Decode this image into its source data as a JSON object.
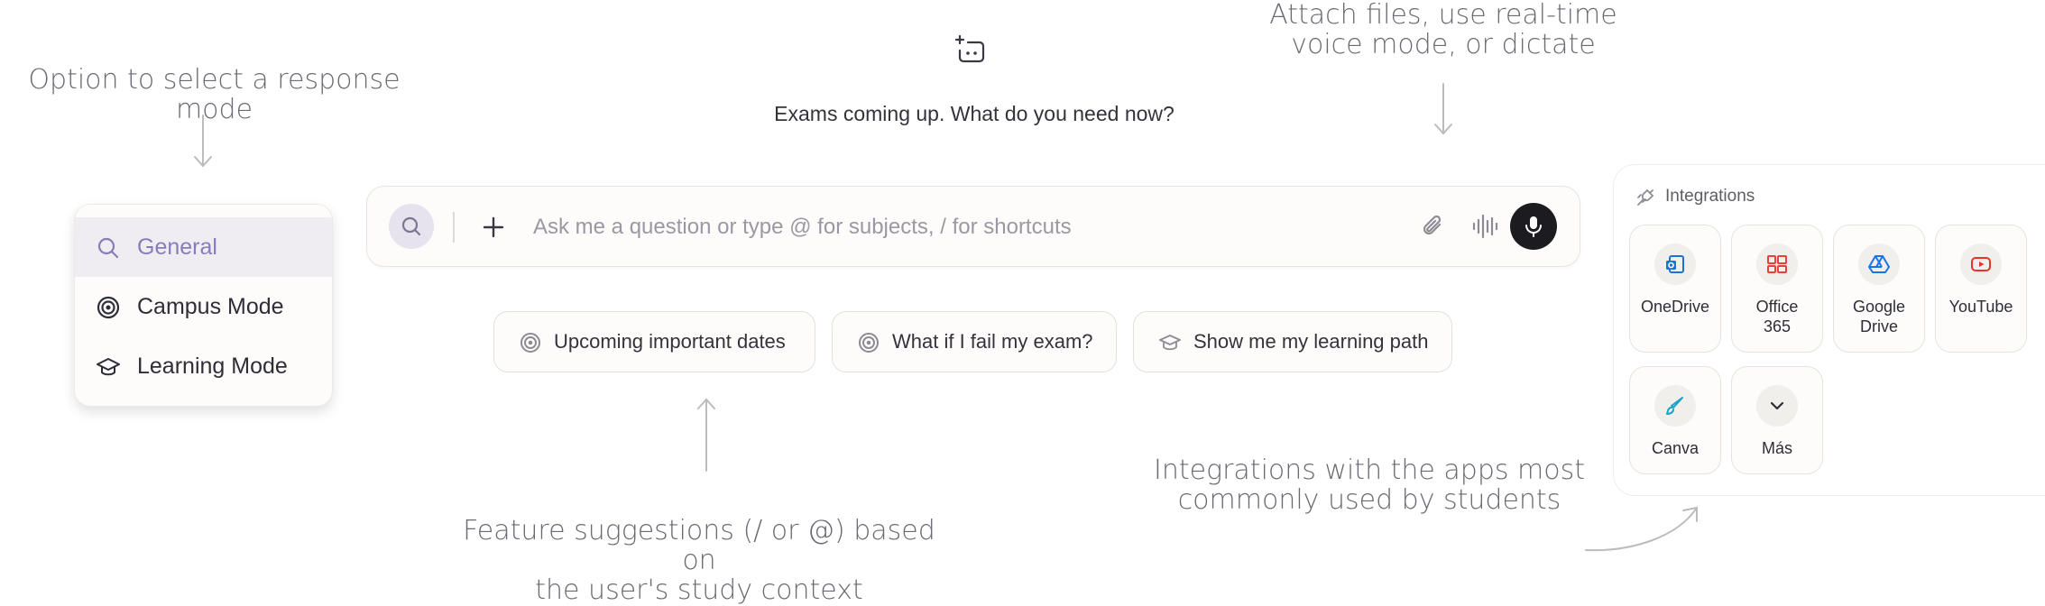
{
  "annotations": {
    "response_mode": "Option to select a response mode",
    "attach": "Attach files, use real-time\nvoice mode, or dictate",
    "suggestions": "Feature suggestions (/ or @) based on\nthe user's study context",
    "integrations": "Integrations with the apps most\ncommonly used by students"
  },
  "greeting": "Exams coming up. What do you need now?",
  "mode_menu": {
    "items": [
      {
        "label": "General",
        "icon": "search-icon",
        "active": true
      },
      {
        "label": "Campus Mode",
        "icon": "target-icon",
        "active": false
      },
      {
        "label": "Learning Mode",
        "icon": "graduation-cap-icon",
        "active": false
      }
    ]
  },
  "composer": {
    "placeholder": "Ask me a question or type @ for subjects, / for shortcuts",
    "value": ""
  },
  "suggestions": [
    {
      "label": "Upcoming important dates",
      "icon": "target-icon"
    },
    {
      "label": "What if I fail my exam?",
      "icon": "target-icon"
    },
    {
      "label": "Show me my learning path",
      "icon": "graduation-cap-icon"
    }
  ],
  "integrations": {
    "title": "Integrations",
    "apps": [
      {
        "name": "OneDrive",
        "icon": "onedrive-icon",
        "color": "#1a73d9"
      },
      {
        "name": "Office\n365",
        "icon": "office365-icon",
        "color": "#e8403a"
      },
      {
        "name": "Google\nDrive",
        "icon": "google-drive-icon",
        "color": "#1a73e8"
      },
      {
        "name": "YouTube",
        "icon": "youtube-icon",
        "color": "#e8322d"
      },
      {
        "name": "Canva",
        "icon": "canva-icon",
        "color": "#1aa3c8"
      },
      {
        "name": "Más",
        "icon": "chevron-down-icon",
        "color": "#2f2d37"
      }
    ]
  },
  "colors": {
    "accent": "#8a7cb8",
    "active_row": "#efedf2",
    "mic_button": "#1c1b20"
  }
}
